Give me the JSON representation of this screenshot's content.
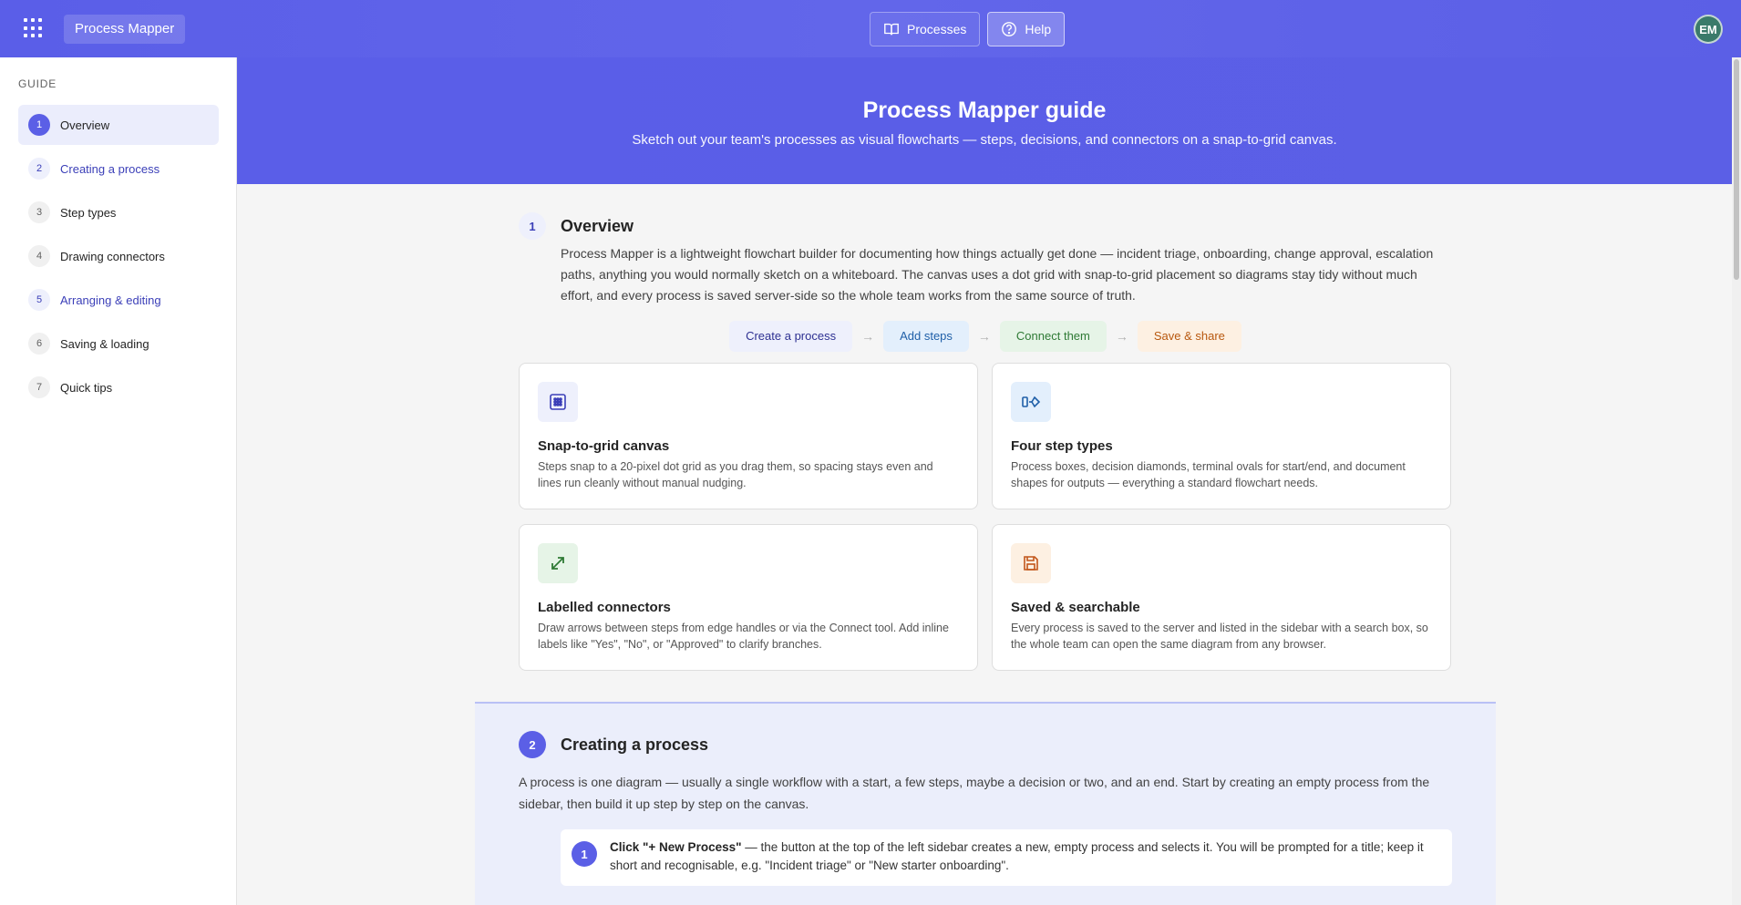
{
  "header": {
    "app_title": "Process Mapper",
    "nav": [
      {
        "label": "Processes",
        "icon": "book-icon",
        "active": false
      },
      {
        "label": "Help",
        "icon": "help-circle-icon",
        "active": true
      }
    ],
    "avatar_initials": "EM"
  },
  "sidebar": {
    "heading": "GUIDE",
    "items": [
      {
        "num": "1",
        "label": "Overview"
      },
      {
        "num": "2",
        "label": "Creating a process"
      },
      {
        "num": "3",
        "label": "Step types"
      },
      {
        "num": "4",
        "label": "Drawing connectors"
      },
      {
        "num": "5",
        "label": "Arranging & editing"
      },
      {
        "num": "6",
        "label": "Saving & loading"
      },
      {
        "num": "7",
        "label": "Quick tips"
      }
    ]
  },
  "hero": {
    "title": "Process Mapper guide",
    "subtitle": "Sketch out your team's processes as visual flowcharts — steps, decisions, and connectors on a snap-to-grid canvas."
  },
  "overview": {
    "num": "1",
    "title": "Overview",
    "body": "Process Mapper is a lightweight flowchart builder for documenting how things actually get done — incident triage, onboarding, change approval, escalation paths, anything you would normally sketch on a whiteboard. The canvas uses a dot grid with snap-to-grid placement so diagrams stay tidy without much effort, and every process is saved server-side so the whole team works from the same source of truth.",
    "flow": [
      "Create a process",
      "Add steps",
      "Connect them",
      "Save & share"
    ],
    "arrow": "→",
    "cards": [
      {
        "icon": "grid-icon",
        "title": "Snap-to-grid canvas",
        "desc": "Steps snap to a 20-pixel dot grid as you drag them, so spacing stays even and lines run cleanly without manual nudging."
      },
      {
        "icon": "step-shapes-icon",
        "title": "Four step types",
        "desc": "Process boxes, decision diamonds, terminal ovals for start/end, and document shapes for outputs — everything a standard flowchart needs."
      },
      {
        "icon": "diagonal-arrow-icon",
        "title": "Labelled connectors",
        "desc": "Draw arrows between steps from edge handles or via the Connect tool. Add inline labels like \"Yes\", \"No\", or \"Approved\" to clarify branches."
      },
      {
        "icon": "save-icon",
        "title": "Saved & searchable",
        "desc": "Every process is saved to the server and listed in the sidebar with a search box, so the whole team can open the same diagram from any browser."
      }
    ]
  },
  "creating": {
    "num": "2",
    "title": "Creating a process",
    "body": "A process is one diagram — usually a single workflow with a start, a few steps, maybe a decision or two, and an end. Start by creating an empty process from the sidebar, then build it up step by step on the canvas.",
    "step1": {
      "num": "1",
      "bold": "Click \"+ New Process\"",
      "text": " — the button at the top of the left sidebar creates a new, empty process and selects it. You will be prompted for a title; keep it short and recognisable, e.g. \"Incident triage\" or \"New starter onboarding\"."
    }
  },
  "colors": {
    "accent": "#5b5fe6",
    "blue": "#1f5fa8",
    "green": "#2f7a35",
    "orange": "#b8580f"
  }
}
